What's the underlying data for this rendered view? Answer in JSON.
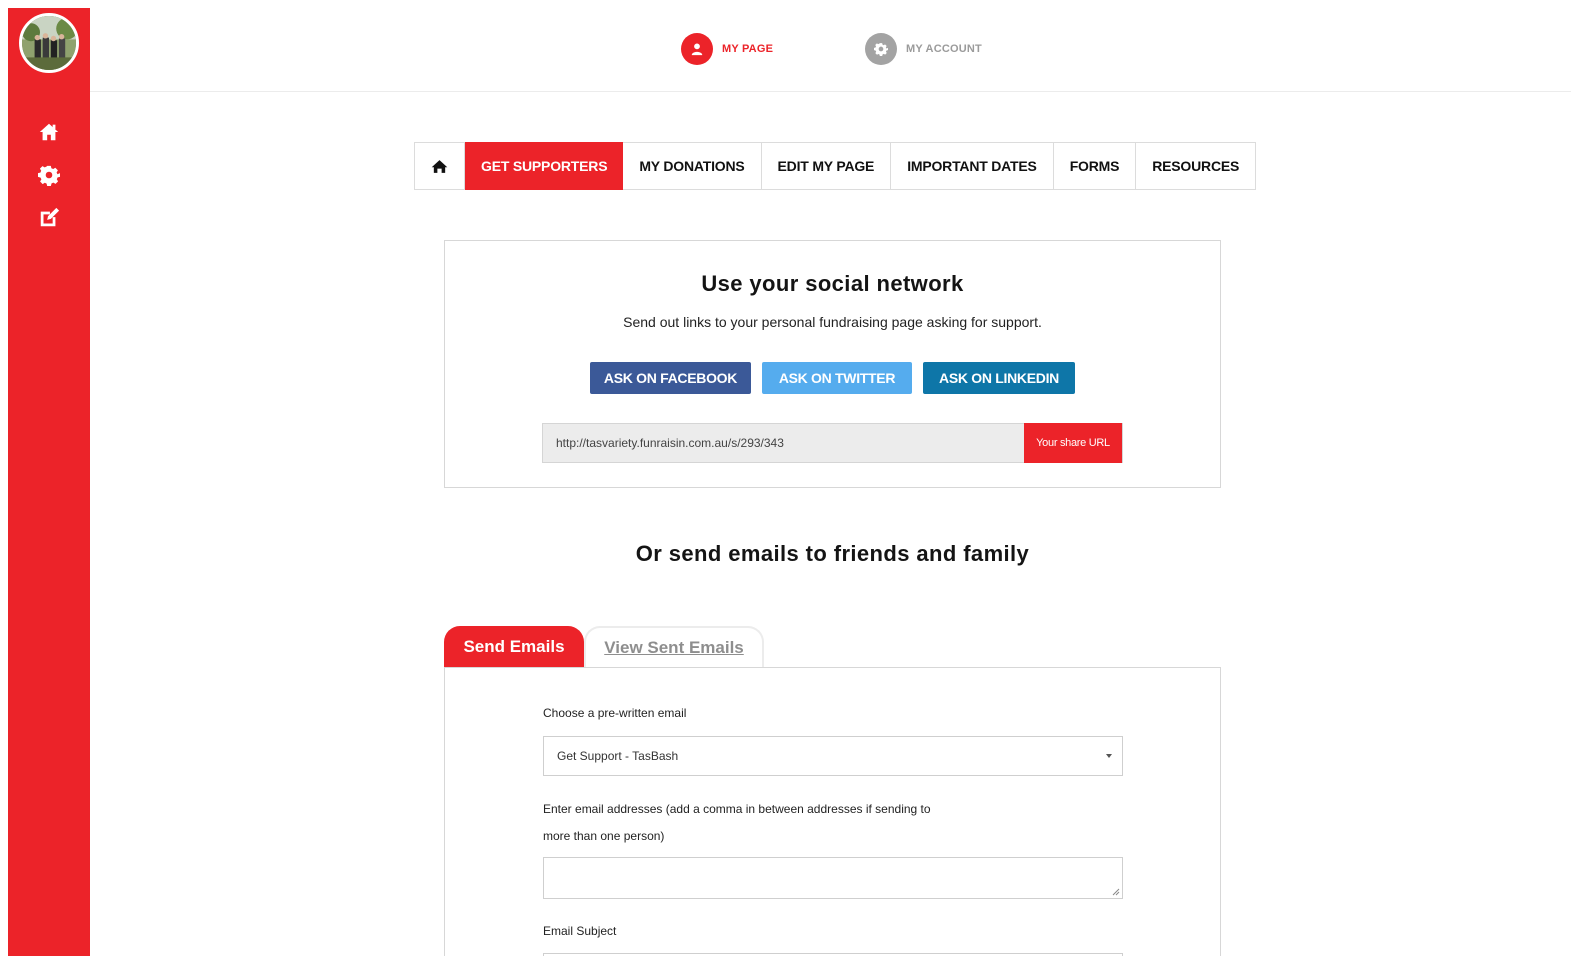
{
  "sidebar": {
    "avatar_alt": "",
    "icons": [
      "home-icon",
      "gear-icon",
      "edit-icon"
    ]
  },
  "header": {
    "my_page": "MY PAGE",
    "my_account": "MY ACCOUNT"
  },
  "tabs": {
    "get_supporters": "GET SUPPORTERS",
    "my_donations": "MY DONATIONS",
    "edit_my_page": "EDIT MY PAGE",
    "important_dates": "IMPORTANT DATES",
    "forms": "FORMS",
    "resources": "RESOURCES"
  },
  "social": {
    "title": "Use your social network",
    "subtitle": "Send out links to your personal fundraising page asking for support.",
    "facebook": "ASK ON FACEBOOK",
    "twitter": "ASK ON TWITTER",
    "linkedin": "ASK ON LINKEDIN",
    "share_url": "http://tasvariety.funraisin.com.au/s/293/343",
    "share_label": "Your share URL"
  },
  "emails": {
    "title": "Or send emails to friends and family",
    "tab_send": "Send Emails",
    "tab_sent": "View Sent Emails",
    "choose_label": "Choose a pre-written email",
    "selected_email": "Get Support - TasBash",
    "addresses_label_1": "Enter email addresses (add a comma in between addresses if sending to",
    "addresses_label_2": "more than one person)",
    "subject_label": "Email Subject"
  },
  "colors": {
    "brand_red": "#ec2329",
    "facebook": "#3b5998",
    "twitter": "#55acee",
    "linkedin": "#0e76a8"
  }
}
